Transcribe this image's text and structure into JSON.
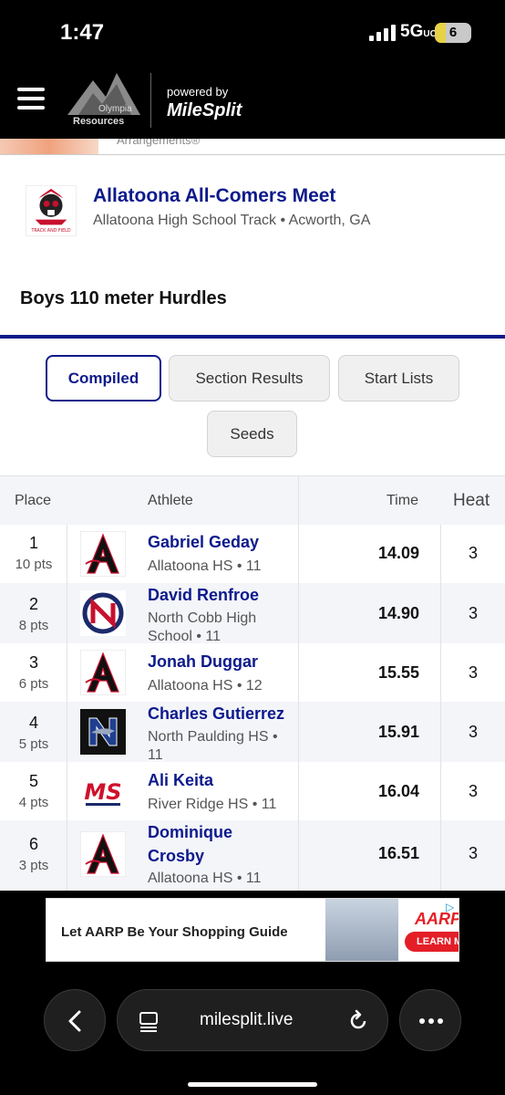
{
  "status": {
    "time": "1:47",
    "network": "5G",
    "network_sub": "UC",
    "battery": "6"
  },
  "header": {
    "logo_top": "Olympia",
    "logo_bottom": "Resources",
    "powered_by": "powered by",
    "brand": "MileSplit"
  },
  "ad_strip": {
    "text": "Arrangements®"
  },
  "meet": {
    "title": "Allatoona All-Comers Meet",
    "location": "Allatoona High School Track • Acworth, GA",
    "logo_caption": "TRACK AND FIELD"
  },
  "event": {
    "title": "Boys 110 meter Hurdles"
  },
  "tabs": [
    {
      "label": "Compiled",
      "active": true
    },
    {
      "label": "Section Results",
      "active": false
    },
    {
      "label": "Start Lists",
      "active": false
    },
    {
      "label": "Seeds",
      "active": false
    }
  ],
  "table": {
    "headers": {
      "place": "Place",
      "athlete": "Athlete",
      "time": "Time",
      "heat": "Heat"
    },
    "rows": [
      {
        "place": "1",
        "pts": "10 pts",
        "name": "Gabriel Geday",
        "school": "Allatoona HS • 11",
        "time": "14.09",
        "heat": "3",
        "logo": "allatoona-logo"
      },
      {
        "place": "2",
        "pts": "8 pts",
        "name": "David Renfroe",
        "school": "North Cobb High School • 11",
        "time": "14.90",
        "heat": "3",
        "logo": "north-cobb-logo"
      },
      {
        "place": "3",
        "pts": "6 pts",
        "name": "Jonah Duggar",
        "school": "Allatoona HS • 12",
        "time": "15.55",
        "heat": "3",
        "logo": "allatoona-logo"
      },
      {
        "place": "4",
        "pts": "5 pts",
        "name": "Charles Gutierrez",
        "school": "North Paulding HS • 11",
        "time": "15.91",
        "heat": "3",
        "logo": "north-paulding-logo"
      },
      {
        "place": "5",
        "pts": "4 pts",
        "name": "Ali Keita",
        "school": "River Ridge HS • 11",
        "time": "16.04",
        "heat": "3",
        "logo": "river-ridge-logo"
      },
      {
        "place": "6",
        "pts": "3 pts",
        "name": "Dominique Crosby",
        "school": "Allatoona HS • 11",
        "time": "16.51",
        "heat": "3",
        "logo": "allatoona-logo"
      }
    ]
  },
  "bottom_ad": {
    "text": "Let AARP Be Your Shopping Guide",
    "brand": "AARP",
    "button": "LEARN MORE"
  },
  "browser": {
    "url": "milesplit.live"
  },
  "colors": {
    "brand_blue": "#0d1a8c",
    "aarp_red": "#e41e26"
  }
}
